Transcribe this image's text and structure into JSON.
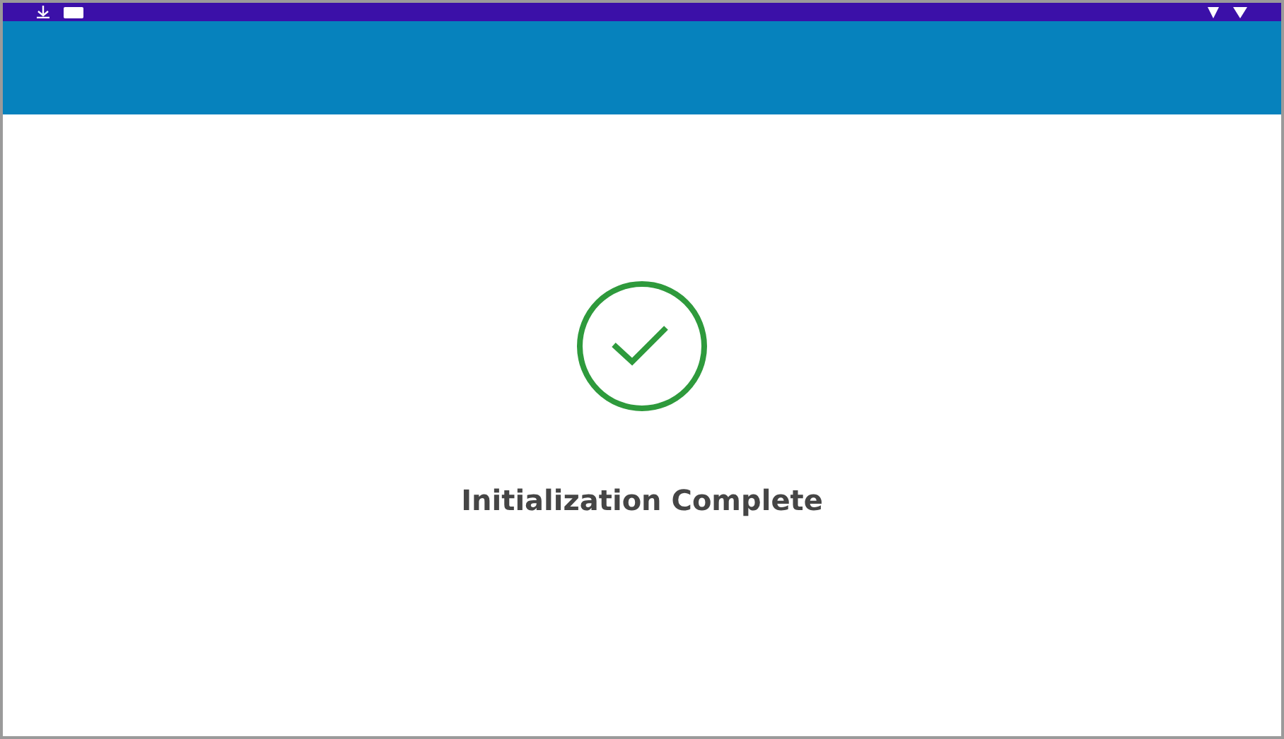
{
  "message": {
    "title": "Initialization Complete",
    "kind": "success"
  }
}
